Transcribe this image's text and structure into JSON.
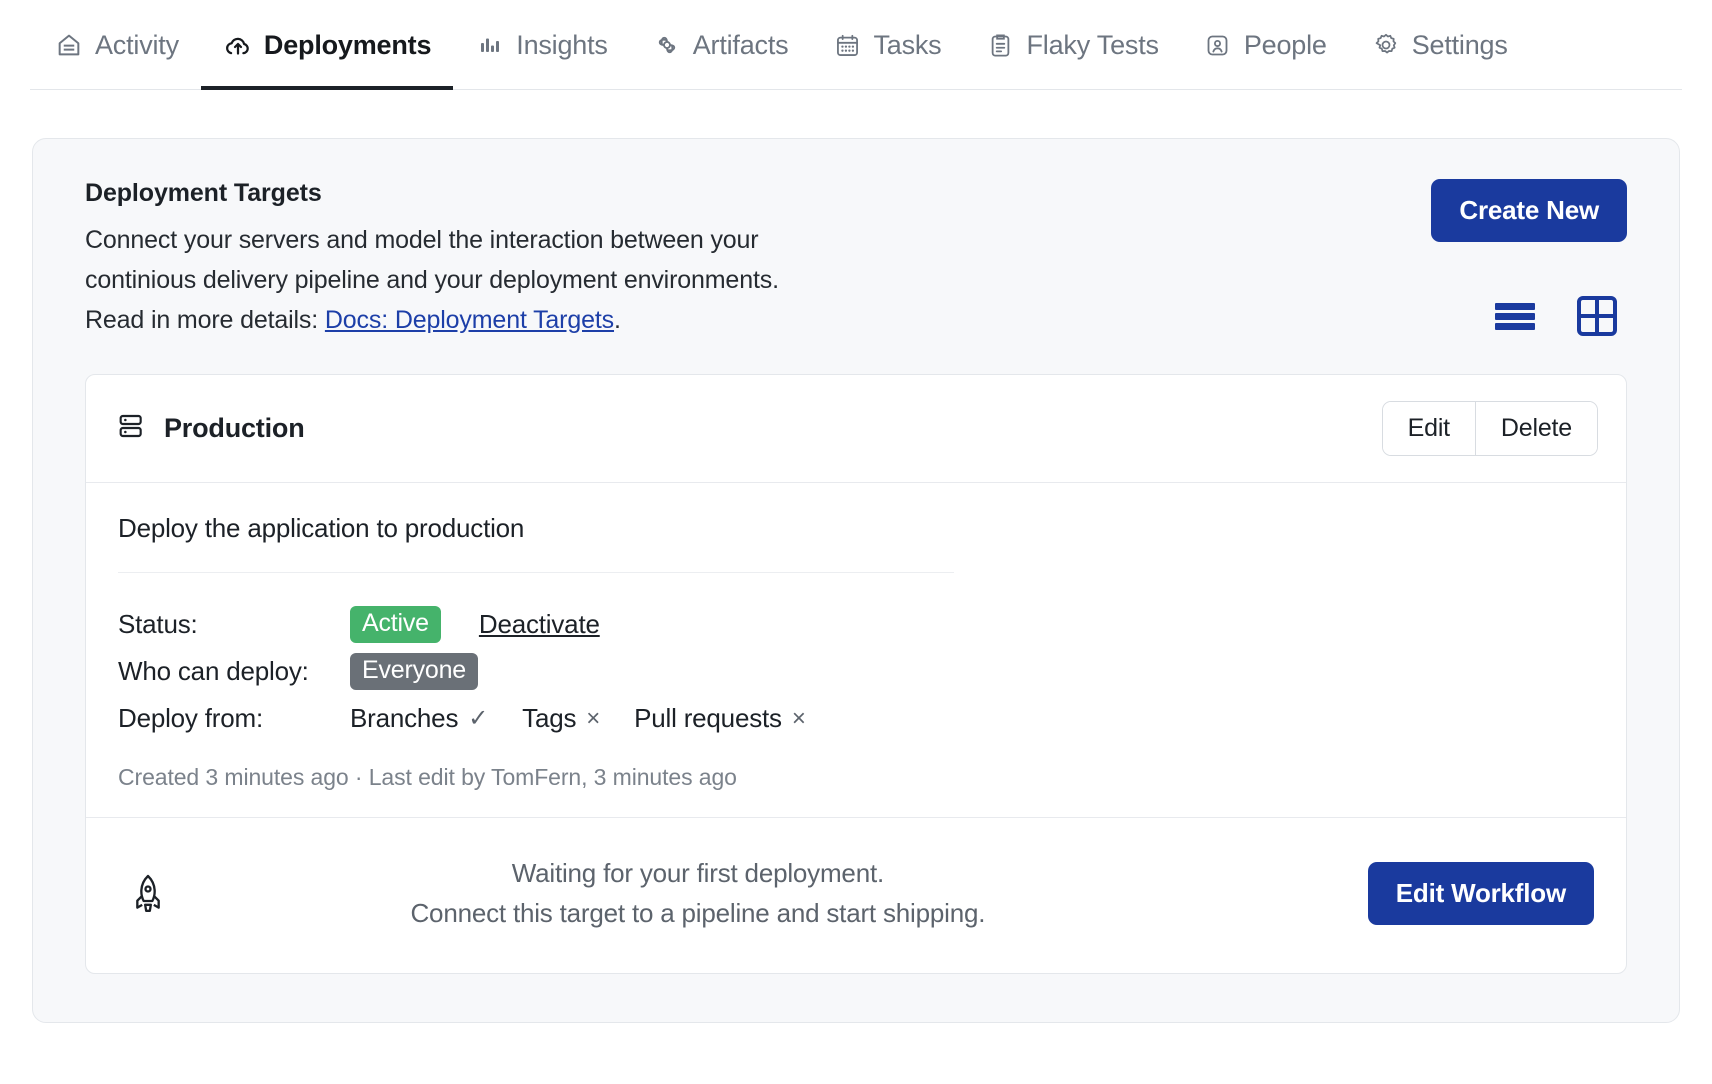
{
  "nav": {
    "items": [
      {
        "label": "Activity",
        "icon": "home-icon",
        "active": false
      },
      {
        "label": "Deployments",
        "icon": "cloud-upload-icon",
        "active": true
      },
      {
        "label": "Insights",
        "icon": "bar-chart-icon",
        "active": false
      },
      {
        "label": "Artifacts",
        "icon": "artifacts-icon",
        "active": false
      },
      {
        "label": "Tasks",
        "icon": "calendar-icon",
        "active": false
      },
      {
        "label": "Flaky Tests",
        "icon": "clipboard-icon",
        "active": false
      },
      {
        "label": "People",
        "icon": "person-icon",
        "active": false
      },
      {
        "label": "Settings",
        "icon": "gear-icon",
        "active": false
      }
    ]
  },
  "panel": {
    "title": "Deployment Targets",
    "desc_line1": "Connect your servers and model the interaction between your",
    "desc_line2": "continious delivery pipeline and your deployment environments.",
    "desc_line3_prefix": "Read in more details: ",
    "desc_link": "Docs: Deployment Targets",
    "desc_line3_suffix": ".",
    "create_button": "Create New",
    "view_toggles": [
      {
        "name": "list-view-toggle",
        "icon": "list-view-icon",
        "selected": true
      },
      {
        "name": "grid-view-toggle",
        "icon": "grid-view-icon",
        "selected": false
      }
    ]
  },
  "target": {
    "icon": "server-stack-icon",
    "name": "Production",
    "edit_label": "Edit",
    "delete_label": "Delete",
    "description": "Deploy the application to production",
    "status_label": "Status:",
    "status_value": "Active",
    "status_action": "Deactivate",
    "who_label": "Who can deploy:",
    "who_value": "Everyone",
    "deploy_from_label": "Deploy from:",
    "deploy_from": [
      {
        "label": "Branches",
        "mark": "✓"
      },
      {
        "label": "Tags",
        "mark": "×"
      },
      {
        "label": "Pull requests",
        "mark": "×"
      }
    ],
    "created": "Created 3 minutes ago · Last edit by TomFern, 3 minutes ago",
    "empty_icon": "rocket-icon",
    "empty_line1": "Waiting for your first deployment.",
    "empty_line2": "Connect this target to a pipeline and start shipping.",
    "empty_button": "Edit Workflow"
  },
  "colors": {
    "primary_blue": "#1a3a9e",
    "active_green": "#45b36b",
    "everyone_gray": "#6a7077",
    "link_blue": "#1d3fa8",
    "panel_bg": "#f7f8fa"
  }
}
